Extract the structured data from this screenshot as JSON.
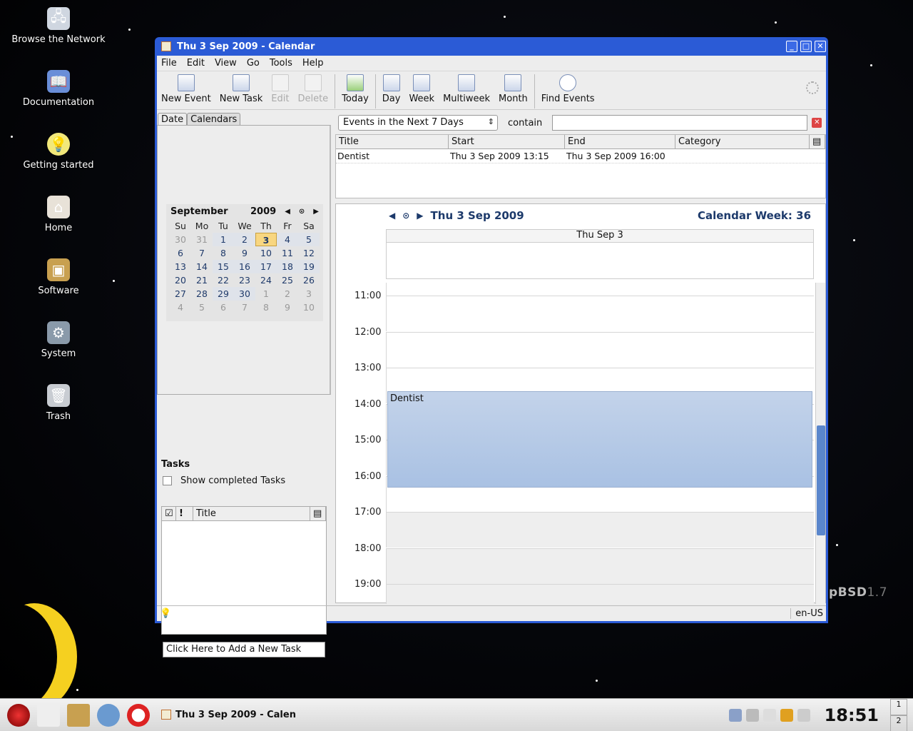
{
  "desktop": {
    "icons": [
      {
        "label": "Browse the Network",
        "icon": "network-icon"
      },
      {
        "label": "Documentation",
        "icon": "book-icon"
      },
      {
        "label": "Getting started",
        "icon": "lightbulb-icon"
      },
      {
        "label": "Home",
        "icon": "home-icon"
      },
      {
        "label": "Software",
        "icon": "package-icon"
      },
      {
        "label": "System",
        "icon": "system-icon"
      },
      {
        "label": "Trash",
        "icon": "trash-icon"
      }
    ],
    "branding": {
      "name": "pBSD",
      "version": "1.7"
    }
  },
  "window": {
    "title": "Thu 3 Sep 2009 - Calendar",
    "menu": [
      "File",
      "Edit",
      "View",
      "Go",
      "Tools",
      "Help"
    ],
    "toolbar": {
      "new_event": "New Event",
      "new_task": "New Task",
      "edit": "Edit",
      "delete": "Delete",
      "today": "Today",
      "day": "Day",
      "week": "Week",
      "multiweek": "Multiweek",
      "month": "Month",
      "find_events": "Find Events"
    },
    "left_tabs": [
      "Date",
      "Calendars"
    ],
    "minicalendar": {
      "month": "September",
      "year": "2009",
      "weekdays": [
        "Su",
        "Mo",
        "Tu",
        "We",
        "Th",
        "Fr",
        "Sa"
      ],
      "days": [
        "30",
        "31",
        "1",
        "2",
        "3",
        "4",
        "5",
        "6",
        "7",
        "8",
        "9",
        "10",
        "11",
        "12",
        "13",
        "14",
        "15",
        "16",
        "17",
        "18",
        "19",
        "20",
        "21",
        "22",
        "23",
        "24",
        "25",
        "26",
        "27",
        "28",
        "29",
        "30",
        "1",
        "2",
        "3",
        "4",
        "5",
        "6",
        "7",
        "8",
        "9",
        "10"
      ],
      "today": "3"
    },
    "tasks": {
      "heading": "Tasks",
      "show_completed": "Show completed Tasks",
      "col_title": "Title",
      "col_priority": "!",
      "add_placeholder": "Click Here to Add a New Task"
    },
    "filter": {
      "range": "Events in the Next 7 Days",
      "contain": "contain",
      "search": ""
    },
    "event_list": {
      "columns": [
        "Title",
        "Start",
        "End",
        "Category"
      ],
      "rows": [
        {
          "title": "Dentist",
          "start": "Thu 3 Sep 2009 13:15",
          "end": "Thu 3 Sep 2009 16:00",
          "category": ""
        }
      ]
    },
    "day_view": {
      "date": "Thu 3 Sep 2009",
      "week": "Calendar Week: 36",
      "column": "Thu Sep 3",
      "hours": [
        "11:00",
        "12:00",
        "13:00",
        "14:00",
        "15:00",
        "16:00",
        "17:00",
        "18:00",
        "19:00"
      ],
      "event": {
        "title": "Dentist"
      }
    },
    "status": {
      "locale": "en-US"
    }
  },
  "taskbar": {
    "task_title": "Thu 3 Sep 2009 - Calen",
    "clock": "18:51",
    "desktops": [
      "1",
      "2"
    ]
  }
}
